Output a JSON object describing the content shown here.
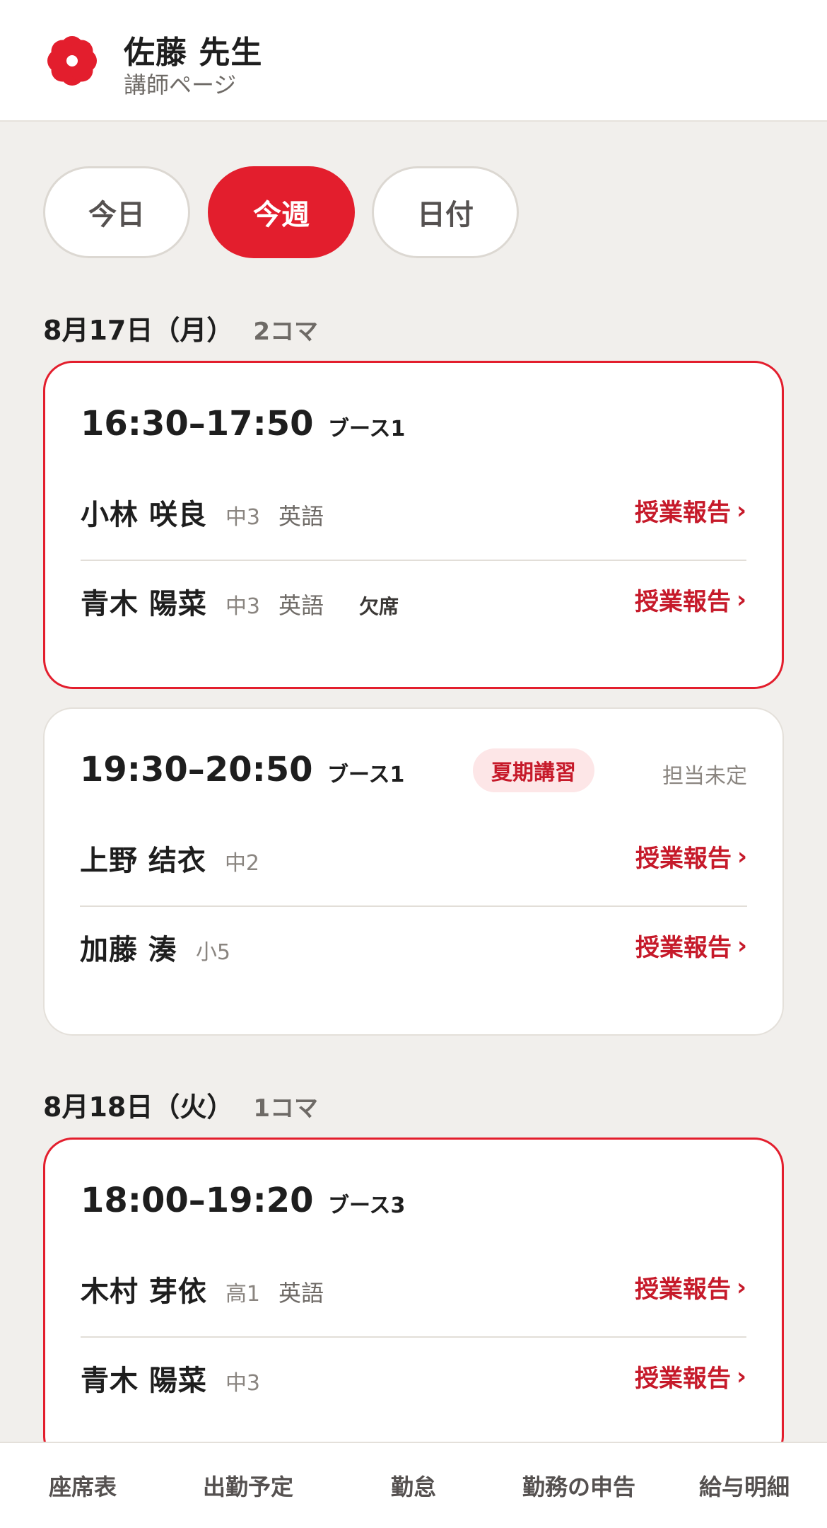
{
  "header": {
    "teacher_name": "佐藤 先生",
    "subtitle": "講師ページ",
    "logo_color": "#e31e2d"
  },
  "filters": [
    {
      "label": "今日",
      "active": false
    },
    {
      "label": "今週",
      "active": true
    },
    {
      "label": "日付",
      "active": false
    }
  ],
  "days": [
    {
      "date": "8月17日（月）",
      "count": "2コマ",
      "slots": [
        {
          "time": "16:30–17:50",
          "booth": "ブース1",
          "current": true,
          "students": [
            {
              "name": "小林 咲良",
              "grade": "中3",
              "subject": "英語",
              "status": "",
              "action": "授業報告"
            },
            {
              "name": "青木 陽菜",
              "grade": "中3",
              "subject": "英語",
              "status": "欠席",
              "action": "授業報告"
            }
          ]
        },
        {
          "time": "19:30–20:50",
          "booth": "ブース1",
          "tag": "夏期講習",
          "assignment": "担当未定",
          "current": false,
          "students": [
            {
              "name": "上野 结衣",
              "grade": "中2",
              "action": "授業報告"
            },
            {
              "name": "加藤 湊",
              "grade": "小5",
              "action": "授業報告"
            }
          ]
        }
      ]
    },
    {
      "date": "8月18日（火）",
      "count": "1コマ",
      "slots": [
        {
          "time": "18:00–19:20",
          "booth": "ブース3",
          "current": true,
          "students": [
            {
              "name": "木村 芽依",
              "grade": "高1",
              "subject": "英語",
              "action": "授業報告"
            },
            {
              "name": "青木 陽菜",
              "grade": "中3",
              "action": "授業報告"
            }
          ]
        }
      ]
    }
  ],
  "chevron": "›",
  "bottom_nav": [
    "座席表",
    "出勤予定",
    "勤怠",
    "勤務の申告",
    "給与明細"
  ],
  "colors": {
    "accent": "#e31e2d",
    "accent_text": "#c61a2a",
    "tag_bg": "#fde6e7",
    "background": "#f1efec"
  }
}
